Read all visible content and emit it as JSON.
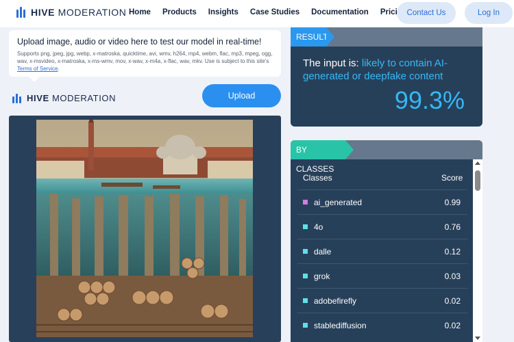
{
  "header": {
    "logo_bold": "HIVE",
    "logo_light": "MODERATION",
    "nav": [
      "Home",
      "Products",
      "Insights",
      "Case Studies",
      "Documentation",
      "Pricing"
    ],
    "contact_label": "Contact Us",
    "login_label": "Log In"
  },
  "upload": {
    "title": "Upload image, audio or video here to test our model in real-time!",
    "supports": "Supports png, jpeg, jpg, webp, x-matroska, quicktime, avi, wmv, h264, mp4, webm, flac, mp3, mpeg, ogg, wav, x-msvideo, x-matroska, x-ms-wmv, mov, x-wav, x-m4a, x-flac, wav, mkv. Use is subject to this site's ",
    "tos_label": "Terms of Service",
    "tos_suffix": ".",
    "button_label": "Upload"
  },
  "result": {
    "tag": "RESULT",
    "prefix": "The input is: ",
    "verdict": "likely to contain AI-generated or deepfake content",
    "score": "99.3%",
    "accent": "#36b8f5"
  },
  "classes": {
    "tag": "BY CLASSES",
    "col_classes": "Classes",
    "col_score": "Score",
    "rows": [
      {
        "name": "ai_generated",
        "score": "0.99",
        "color": "#d77be0"
      },
      {
        "name": "4o",
        "score": "0.76",
        "color": "#5fe0e8"
      },
      {
        "name": "dalle",
        "score": "0.12",
        "color": "#5fe0e8"
      },
      {
        "name": "grok",
        "score": "0.03",
        "color": "#5fe0e8"
      },
      {
        "name": "adobefirefly",
        "score": "0.02",
        "color": "#5fe0e8"
      },
      {
        "name": "stablediffusion",
        "score": "0.02",
        "color": "#5fe0e8"
      }
    ]
  }
}
